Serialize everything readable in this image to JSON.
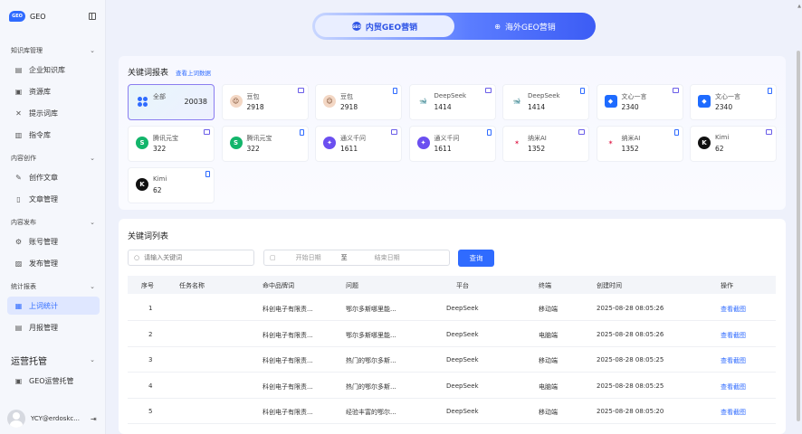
{
  "app": {
    "logo_badge": "GEO",
    "logo_text": "GEO"
  },
  "sidebar": {
    "groups": [
      {
        "label": "知识库管理"
      },
      {
        "label": "内容创作"
      },
      {
        "label": "内容发布"
      },
      {
        "label": "统计报表"
      }
    ],
    "items": [
      {
        "label": "企业知识库",
        "icon": "book-icon"
      },
      {
        "label": "资源库",
        "icon": "box-icon"
      },
      {
        "label": "提示词库",
        "icon": "magic-icon"
      },
      {
        "label": "指令库",
        "icon": "folder-icon"
      },
      {
        "label": "创作文章",
        "icon": "pen-icon"
      },
      {
        "label": "文章管理",
        "icon": "doc-icon"
      },
      {
        "label": "账号管理",
        "icon": "gear-icon"
      },
      {
        "label": "发布管理",
        "icon": "edit-icon"
      },
      {
        "label": "上词统计",
        "icon": "chart-icon"
      },
      {
        "label": "月报管理",
        "icon": "calendar-icon"
      }
    ],
    "big_group": "运营托管",
    "big_item": {
      "label": "GEO运营托管",
      "icon": "service-icon"
    },
    "user": "YCY@erdoskc..."
  },
  "tabs": {
    "active": "内贸GEO营销",
    "inactive": "海外GEO营销",
    "active_badge": "GEO"
  },
  "report": {
    "title": "关键词报表",
    "link": "查看上词数据",
    "cards": [
      {
        "name": "全部",
        "value": "20038",
        "icon": "grid-icon",
        "device": "",
        "selected": true
      },
      {
        "name": "豆包",
        "value": "2918",
        "icon": "doubao-icon",
        "device": "pc"
      },
      {
        "name": "豆包",
        "value": "2918",
        "icon": "doubao-icon",
        "device": "mobile"
      },
      {
        "name": "DeepSeek",
        "value": "1414",
        "icon": "deepseek-icon",
        "device": "pc"
      },
      {
        "name": "DeepSeek",
        "value": "1414",
        "icon": "deepseek-icon",
        "device": "mobile"
      },
      {
        "name": "文心一言",
        "value": "2340",
        "icon": "wenxin-icon",
        "device": "pc"
      },
      {
        "name": "文心一言",
        "value": "2340",
        "icon": "wenxin-icon",
        "device": "mobile"
      },
      {
        "name": "腾讯元宝",
        "value": "322",
        "icon": "yuanbao-icon",
        "device": "pc"
      },
      {
        "name": "腾讯元宝",
        "value": "322",
        "icon": "yuanbao-icon",
        "device": "mobile"
      },
      {
        "name": "通义千问",
        "value": "1611",
        "icon": "tongyi-icon",
        "device": "pc"
      },
      {
        "name": "通义千问",
        "value": "1611",
        "icon": "tongyi-icon",
        "device": "mobile"
      },
      {
        "name": "纳米AI",
        "value": "1352",
        "icon": "nami-icon",
        "device": "pc"
      },
      {
        "name": "纳米AI",
        "value": "1352",
        "icon": "nami-icon",
        "device": "mobile"
      },
      {
        "name": "Kimi",
        "value": "62",
        "icon": "kimi-icon",
        "device": "pc"
      },
      {
        "name": "Kimi",
        "value": "62",
        "icon": "kimi-icon",
        "device": "mobile"
      }
    ]
  },
  "list": {
    "title": "关键词列表",
    "search_placeholder": "请输入关键词",
    "start_placeholder": "开始日期",
    "to": "至",
    "end_placeholder": "结束日期",
    "query": "查询",
    "columns": [
      "序号",
      "任务名称",
      "命中品牌词",
      "问题",
      "平台",
      "终端",
      "创建时间",
      "操作"
    ],
    "rows": [
      {
        "no": "1",
        "task": "",
        "brand": "科创电子有限责...",
        "question": "鄂尔多斯哪里能...",
        "platform": "DeepSeek",
        "device": "移动端",
        "time": "2025-08-28 08:05:26",
        "action": "查看截图"
      },
      {
        "no": "2",
        "task": "",
        "brand": "科创电子有限责...",
        "question": "鄂尔多斯哪里能...",
        "platform": "DeepSeek",
        "device": "电脑端",
        "time": "2025-08-28 08:05:26",
        "action": "查看截图"
      },
      {
        "no": "3",
        "task": "",
        "brand": "科创电子有限责...",
        "question": "热门的鄂尔多斯...",
        "platform": "DeepSeek",
        "device": "移动端",
        "time": "2025-08-28 08:05:25",
        "action": "查看截图"
      },
      {
        "no": "4",
        "task": "",
        "brand": "科创电子有限责...",
        "question": "热门的鄂尔多斯...",
        "platform": "DeepSeek",
        "device": "电脑端",
        "time": "2025-08-28 08:05:25",
        "action": "查看截图"
      },
      {
        "no": "5",
        "task": "",
        "brand": "科创电子有限责...",
        "question": "经验丰富的鄂尔...",
        "platform": "DeepSeek",
        "device": "移动端",
        "time": "2025-08-28 08:05:20",
        "action": "查看截图"
      }
    ]
  }
}
